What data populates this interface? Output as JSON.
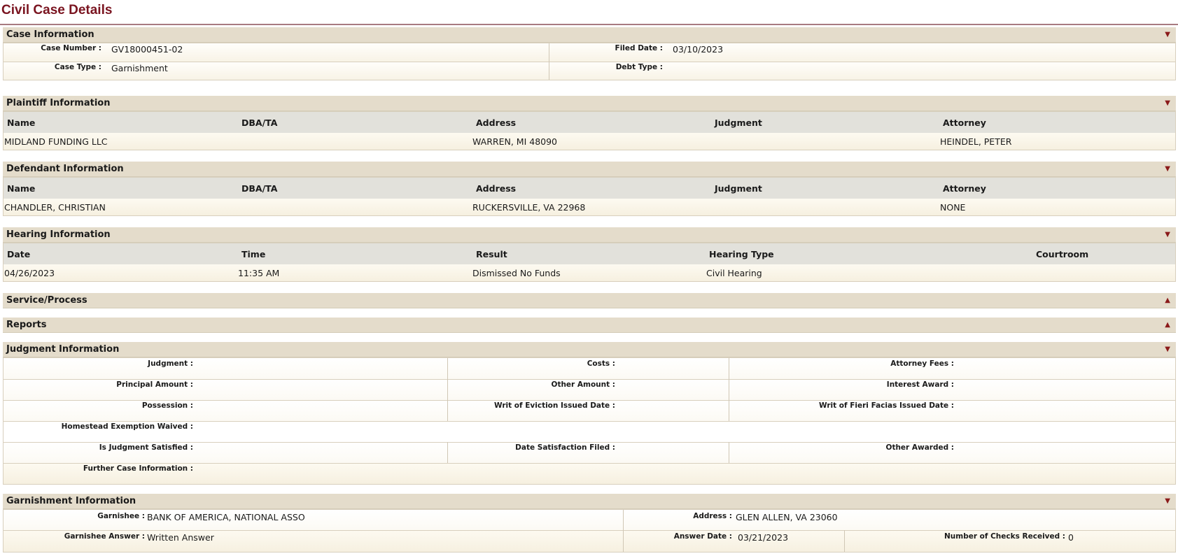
{
  "page_title": "Civil Case Details",
  "case_info": {
    "title": "Case Information",
    "arrow": "▼",
    "case_number_label": "Case Number :",
    "case_number": "GV18000451-02",
    "filed_date_label": "Filed Date :",
    "filed_date": "03/10/2023",
    "case_type_label": "Case Type :",
    "case_type": "Garnishment",
    "debt_type_label": "Debt Type :",
    "debt_type": ""
  },
  "plaintiff": {
    "title": "Plaintiff Information",
    "arrow": "▼",
    "columns": [
      "Name",
      "DBA/TA",
      "Address",
      "Judgment",
      "Attorney"
    ],
    "row": [
      "MIDLAND FUNDING LLC",
      "",
      "WARREN, MI 48090",
      "",
      "HEINDEL, PETER"
    ]
  },
  "defendant": {
    "title": "Defendant Information",
    "arrow": "▼",
    "columns": [
      "Name",
      "DBA/TA",
      "Address",
      "Judgment",
      "Attorney"
    ],
    "row": [
      "CHANDLER, CHRISTIAN",
      "",
      "RUCKERSVILLE, VA 22968",
      "",
      "NONE"
    ]
  },
  "hearing": {
    "title": "Hearing Information",
    "arrow": "▼",
    "columns": [
      "Date",
      "Time",
      "Result",
      "Hearing Type",
      "Courtroom"
    ],
    "row": [
      "04/26/2023",
      "11:35 AM",
      "Dismissed No Funds",
      "Civil Hearing",
      ""
    ]
  },
  "service": {
    "title": "Service/Process",
    "arrow": "▲"
  },
  "reports": {
    "title": "Reports",
    "arrow": "▲"
  },
  "judgment": {
    "title": "Judgment Information",
    "arrow": "▼",
    "judgment_label": "Judgment :",
    "costs_label": "Costs :",
    "attorney_fees_label": "Attorney Fees :",
    "principal_label": "Principal Amount :",
    "other_amount_label": "Other Amount :",
    "interest_label": "Interest Award :",
    "possession_label": "Possession :",
    "eviction_label": "Writ of Eviction Issued Date :",
    "fieri_label": "Writ of Fieri Facias Issued Date :",
    "homestead_label": "Homestead Exemption Waived :",
    "satisfied_label": "Is Judgment Satisfied :",
    "satisfaction_date_label": "Date Satisfaction Filed :",
    "other_awarded_label": "Other Awarded :",
    "further_label": "Further Case Information :"
  },
  "garnishment": {
    "title": "Garnishment Information",
    "arrow": "▼",
    "garnishee_label": "Garnishee :",
    "garnishee": "BANK OF AMERICA, NATIONAL ASSO",
    "address_label": "Address :",
    "address": "GLEN ALLEN, VA 23060",
    "answer_label": "Garnishee Answer :",
    "answer": "Written Answer",
    "answer_date_label": "Answer Date :",
    "answer_date": "03/21/2023",
    "checks_label": "Number of Checks Received :",
    "checks": "0"
  }
}
